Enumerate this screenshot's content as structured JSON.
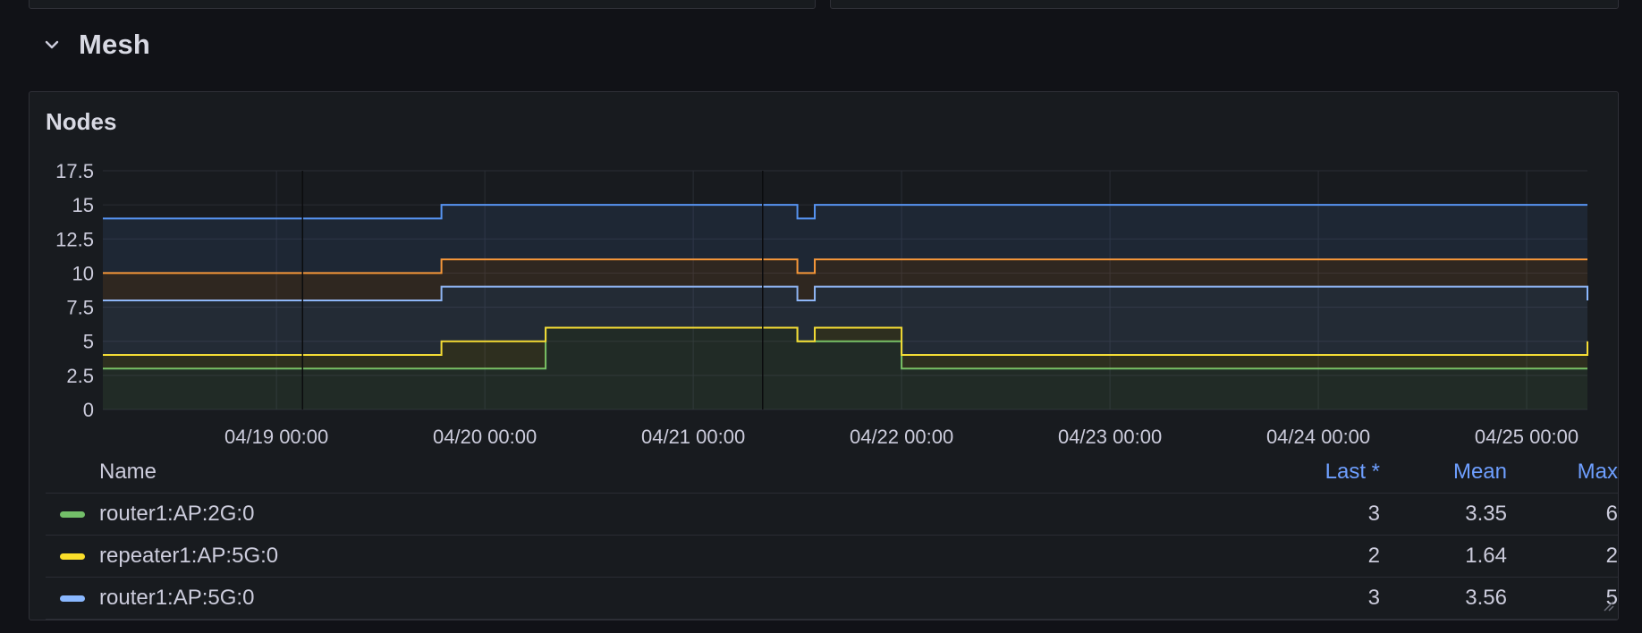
{
  "row": {
    "title": "Mesh"
  },
  "panel": {
    "title": "Nodes"
  },
  "colors": {
    "green": "#73bf69",
    "yellow": "#fade2a",
    "blue": "#8ab8ff",
    "orange": "#ff9830",
    "blue_dark": "#5794f2"
  },
  "legend": {
    "headers": {
      "name": "Name",
      "last": "Last *",
      "mean": "Mean",
      "max": "Max"
    },
    "rows": [
      {
        "name": "router1:AP:2G:0",
        "color": "#73bf69",
        "last": "3",
        "mean": "3.35",
        "max": "6"
      },
      {
        "name": "repeater1:AP:5G:0",
        "color": "#fade2a",
        "last": "2",
        "mean": "1.64",
        "max": "2"
      },
      {
        "name": "router1:AP:5G:0",
        "color": "#8ab8ff",
        "last": "3",
        "mean": "3.56",
        "max": "5"
      }
    ]
  },
  "chart_data": {
    "type": "area",
    "stacked": true,
    "grid": true,
    "x_ticks": [
      "04/19 00:00",
      "04/20 00:00",
      "04/21 00:00",
      "04/22 00:00",
      "04/23 00:00",
      "04/24 00:00",
      "04/25 00:00"
    ],
    "y_ticks": [
      "0",
      "2.5",
      "5",
      "7.5",
      "10",
      "12.5",
      "15",
      "17.5"
    ],
    "ylim": [
      0,
      17.5
    ],
    "series": [
      {
        "name": "router1:AP:2G:0",
        "color": "#73bf69",
        "x": [
          "04/18 04:00",
          "04/20 06:00",
          "04/20 07:00",
          "04/21 12:00",
          "04/22 00:00",
          "04/25 07:00"
        ],
        "values": [
          3,
          3,
          6,
          5,
          3,
          3
        ]
      },
      {
        "name": "repeater1:AP:5G:0",
        "color": "#fade2a",
        "x": [
          "04/18 04:00",
          "04/19 19:00",
          "04/20 07:00",
          "04/21 12:00",
          "04/21 14:00",
          "04/22 00:00",
          "04/22 09:00",
          "04/25 07:00"
        ],
        "values": [
          1,
          2,
          0,
          0,
          1,
          1,
          1,
          2
        ]
      },
      {
        "name": "router1:AP:5G:0",
        "color": "#8ab8ff",
        "x": [
          "04/18 04:00",
          "04/20 07:00",
          "04/21 12:00",
          "04/22 00:00",
          "04/25 07:00"
        ],
        "values": [
          4,
          3,
          3,
          5,
          3
        ]
      },
      {
        "name": "",
        "color": "#ff9830",
        "x": [
          "04/18 04:00",
          "04/20 07:00",
          "04/21 12:00",
          "04/25 07:00"
        ],
        "values": [
          2,
          2,
          2,
          3
        ]
      },
      {
        "name": "",
        "color": "#5794f2",
        "x": [
          "04/18 04:00",
          "04/20 07:00",
          "04/21 12:00",
          "04/25 07:00"
        ],
        "values": [
          4,
          4,
          4,
          4
        ]
      }
    ]
  }
}
